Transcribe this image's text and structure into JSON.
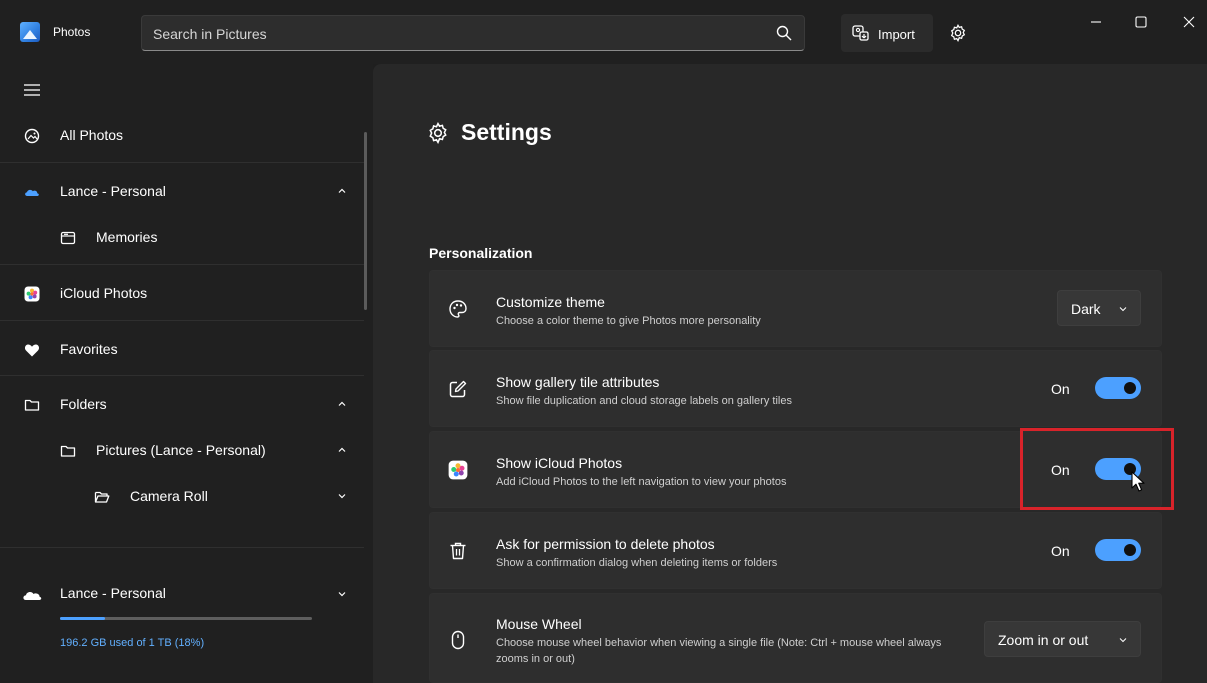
{
  "app": {
    "title": "Photos"
  },
  "search": {
    "placeholder": "Search in Pictures"
  },
  "toolbar": {
    "import_label": "Import"
  },
  "sidebar": {
    "items": [
      {
        "label": "All Photos",
        "icon": "all-photos-icon"
      },
      {
        "label": "Lance - Personal",
        "icon": "onedrive-cloud-icon",
        "chevron": "up"
      },
      {
        "label": "Memories",
        "icon": "memories-icon"
      },
      {
        "label": "iCloud Photos",
        "icon": "icloud-photos-icon"
      },
      {
        "label": "Favorites",
        "icon": "heart-icon"
      },
      {
        "label": "Folders",
        "icon": "folder-icon",
        "chevron": "up"
      },
      {
        "label": "Pictures (Lance - Personal)",
        "icon": "folder-icon",
        "chevron": "up"
      },
      {
        "label": "Camera Roll",
        "icon": "folder-open-icon",
        "chevron": "down"
      }
    ],
    "account": {
      "label": "Lance - Personal",
      "storage_text": "196.2 GB used of 1 TB (18%)",
      "storage_percent": 18
    }
  },
  "settings": {
    "heading": "Settings",
    "section": "Personalization",
    "cards": [
      {
        "title": "Customize theme",
        "desc": "Choose a color theme to give Photos more personality",
        "control": "dropdown",
        "value": "Dark",
        "icon": "palette-icon"
      },
      {
        "title": "Show gallery tile attributes",
        "desc": "Show file duplication and cloud storage labels on gallery tiles",
        "control": "toggle",
        "value": "On",
        "icon": "edit-icon"
      },
      {
        "title": "Show iCloud Photos",
        "desc": "Add iCloud Photos to the left navigation to view your photos",
        "control": "toggle",
        "value": "On",
        "icon": "icloud-photos-icon"
      },
      {
        "title": "Ask for permission to delete photos",
        "desc": "Show a confirmation dialog when deleting items or folders",
        "control": "toggle",
        "value": "On",
        "icon": "trash-icon"
      },
      {
        "title": "Mouse Wheel",
        "desc": "Choose mouse wheel behavior when viewing a single file (Note: Ctrl + mouse wheel always zooms in or out)",
        "control": "dropdown",
        "value": "Zoom in or out",
        "icon": "mouse-icon"
      }
    ]
  },
  "colors": {
    "accent": "#4ca0ff",
    "highlight": "#d8232a",
    "background": "#282828",
    "sidebar": "#202020"
  }
}
